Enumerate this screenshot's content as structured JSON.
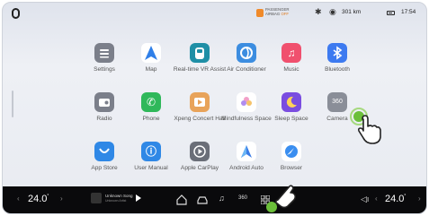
{
  "status": {
    "airbag_line1": "PASSENGER",
    "airbag_line2": "AIRBAG",
    "airbag_state": "OFF",
    "range": "301 km",
    "time": "17:54"
  },
  "apps": [
    {
      "label": "Settings",
      "icon": "settings-icon",
      "color": "#7b7f8a"
    },
    {
      "label": "Map",
      "icon": "map-icon",
      "color": "#ffffff"
    },
    {
      "label": "Real-time VR Assist",
      "icon": "vr-assist-icon",
      "color": "#1f8fa6"
    },
    {
      "label": "Air Conditioner",
      "icon": "air-conditioner-icon",
      "color": "#3c8de0"
    },
    {
      "label": "Music",
      "icon": "music-icon",
      "color": "#f0506e"
    },
    {
      "label": "Bluetooth",
      "icon": "bluetooth-icon",
      "color": "#3d7af0"
    },
    {
      "label": "Radio",
      "icon": "radio-icon",
      "color": "#7b7f8a"
    },
    {
      "label": "Phone",
      "icon": "phone-icon",
      "color": "#2fb85a"
    },
    {
      "label": "Xpeng Concert Hall",
      "icon": "concert-hall-icon",
      "color": "#e8a35a"
    },
    {
      "label": "Mindfulness Space",
      "icon": "mindfulness-icon",
      "color": "#ffffff"
    },
    {
      "label": "Sleep Space",
      "icon": "sleep-space-icon",
      "color": "#7a4de0"
    },
    {
      "label": "Camera",
      "icon": "camera-360-icon",
      "color": "#8a8e98"
    },
    {
      "label": "App Store",
      "icon": "app-store-icon",
      "color": "#2f88e6"
    },
    {
      "label": "User Manual",
      "icon": "user-manual-icon",
      "color": "#2f88e6"
    },
    {
      "label": "Apple CarPlay",
      "icon": "carplay-icon",
      "color": "#6a6e78"
    },
    {
      "label": "Android Auto",
      "icon": "android-auto-icon",
      "color": "#ffffff"
    },
    {
      "label": "Browser",
      "icon": "browser-icon",
      "color": "#ffffff"
    }
  ],
  "dock": {
    "left_temp": "24.0",
    "left_temp_unit": "°",
    "right_temp": "24.0",
    "right_temp_unit": "°",
    "song": "Unknown Song",
    "artist": "Unknown Artist",
    "icons": [
      "home-icon",
      "car-icon",
      "music-note-icon",
      "camera-360-icon",
      "apps-grid-icon",
      "volume-icon"
    ]
  },
  "colors": {
    "accent_green": "#6bbf3a",
    "dock_bg": "#0a0a0c"
  }
}
